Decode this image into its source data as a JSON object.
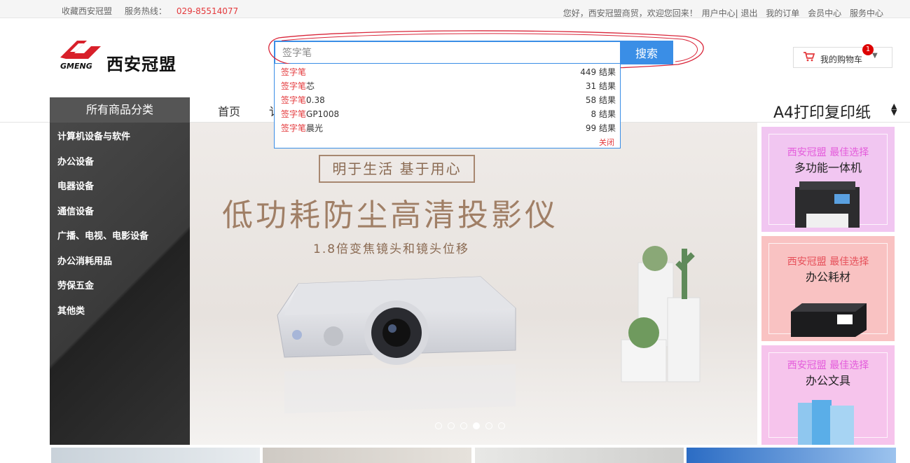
{
  "topbar": {
    "bookmark": "收藏西安冠盟",
    "hotline_label": "服务热线：",
    "hotline_number": "029-85514077",
    "greeting": "您好，西安冠盟商贸，欢迎您回来！",
    "user_center": "用户中心|",
    "logout": "退出",
    "my_orders": "我的订单",
    "member_center": "会员中心",
    "service_center": "服务中心"
  },
  "logo": {
    "name": "西安冠盟",
    "sub": "GMENG"
  },
  "search": {
    "value": "签字笔",
    "button": "搜索",
    "suggestions": [
      {
        "highlight": "签字笔",
        "rest": "",
        "count": "449 结果"
      },
      {
        "highlight": "签字笔",
        "rest": "芯",
        "count": "31 结果"
      },
      {
        "highlight": "签字笔",
        "rest": "0.38",
        "count": "58 结果"
      },
      {
        "highlight": "签字笔",
        "rest": "GP1008",
        "count": "8 结果"
      },
      {
        "highlight": "签字笔",
        "rest": "晨光",
        "count": "99 结果"
      }
    ],
    "close": "关闭"
  },
  "cart": {
    "label": "我的购物车",
    "count": "1"
  },
  "nav": {
    "home": "首页",
    "partial": "讠",
    "right_label": "A4打印复印纸"
  },
  "sidebar": {
    "title": "所有商品分类",
    "categories": [
      "计算机设备与软件",
      "办公设备",
      "电器设备",
      "通信设备",
      "广播、电视、电影设备",
      "办公消耗用品",
      "劳保五金",
      "其他类"
    ]
  },
  "banner": {
    "slogan": "明于生活 基于用心",
    "title": "低功耗防尘高清投影仪",
    "subtitle": "1.8倍变焦镜头和镜头位移",
    "slides_total": 6,
    "active_slide": 4
  },
  "promos": [
    {
      "tag": "西安冠盟 最佳选择",
      "title": "多功能一体机",
      "bg": "#f1c6f1",
      "tag_color": "#e45cdb"
    },
    {
      "tag": "西安冠盟 最佳选择",
      "title": "办公耗材",
      "bg": "#f9c2c2",
      "tag_color": "#e6505a"
    },
    {
      "tag": "西安冠盟 最佳选择",
      "title": "办公文具",
      "bg": "#f6c4ec",
      "tag_color": "#e45cdb"
    }
  ],
  "colors": {
    "accent": "#3a8ee6",
    "highlight": "#e4393c"
  }
}
